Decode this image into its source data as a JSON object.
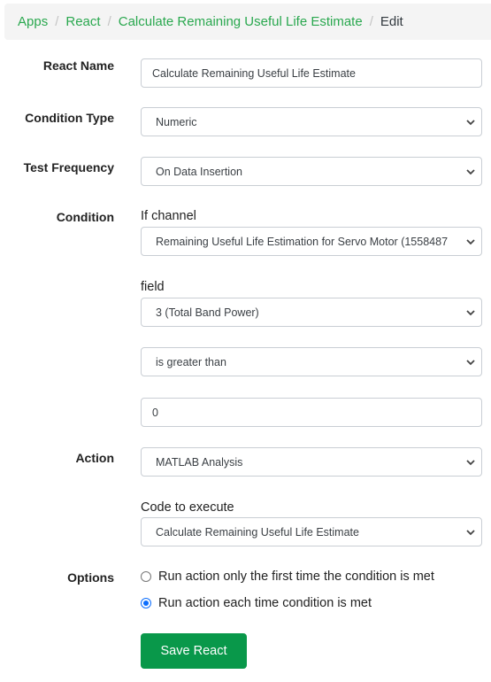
{
  "breadcrumb": {
    "items": [
      "Apps",
      "React",
      "Calculate Remaining Useful Life Estimate"
    ],
    "current": "Edit",
    "separator": "/"
  },
  "form": {
    "react_name": {
      "label": "React Name",
      "value": "Calculate Remaining Useful Life Estimate"
    },
    "condition_type": {
      "label": "Condition Type",
      "value": "Numeric"
    },
    "test_frequency": {
      "label": "Test Frequency",
      "value": "On Data Insertion"
    },
    "condition": {
      "label": "Condition",
      "channel_label": "If channel",
      "channel_value": "Remaining Useful Life Estimation for Servo Motor (1558487",
      "field_label": "field",
      "field_value": "3 (Total Band Power)",
      "operator_value": "is greater than",
      "threshold_value": "0"
    },
    "action": {
      "label": "Action",
      "value": "MATLAB Analysis",
      "code_label": "Code to execute",
      "code_value": "Calculate Remaining Useful Life Estimate"
    },
    "options": {
      "label": "Options",
      "choices": [
        {
          "label": "Run action only the first time the condition is met",
          "checked": false
        },
        {
          "label": "Run action each time condition is met",
          "checked": true
        }
      ]
    },
    "save_label": "Save React"
  },
  "colors": {
    "link": "#2aa84f",
    "primary_button": "#09984a",
    "radio_checked": "#0d6efd"
  }
}
